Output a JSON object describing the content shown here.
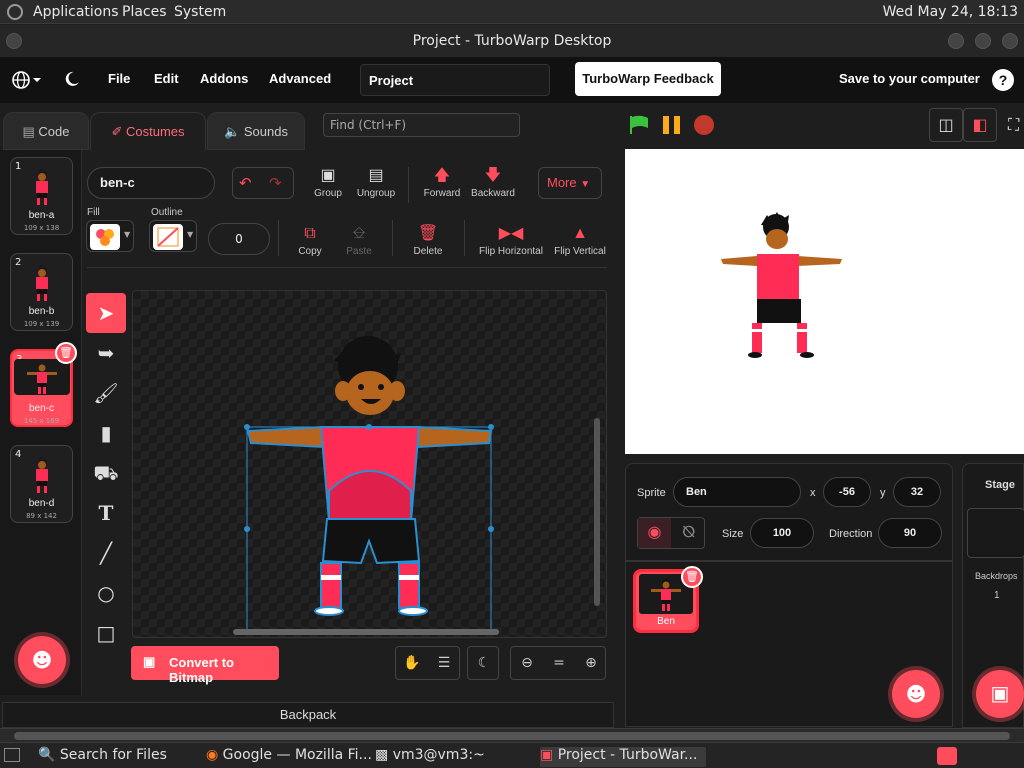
{
  "system_bar": {
    "menus": [
      "Applications",
      "Places",
      "System"
    ],
    "clock": "Wed May 24, 18:13"
  },
  "window": {
    "title": "Project - TurboWarp Desktop"
  },
  "menubar": {
    "items": [
      "File",
      "Edit",
      "Addons",
      "Advanced"
    ],
    "project_title": "Project",
    "feedback_label": "TurboWarp Feedback",
    "save_label": "Save to your computer",
    "help_glyph": "?"
  },
  "tabs": [
    {
      "label": "Code",
      "icon": "code-icon"
    },
    {
      "label": "Costumes",
      "icon": "brush-icon"
    },
    {
      "label": "Sounds",
      "icon": "speaker-icon"
    }
  ],
  "find": {
    "placeholder": "Find (Ctrl+F)"
  },
  "costumes": [
    {
      "num": "1",
      "name": "ben-a",
      "size": "109 x 138"
    },
    {
      "num": "2",
      "name": "ben-b",
      "size": "109 x 139"
    },
    {
      "num": "3",
      "name": "ben-c",
      "size": "145 x 169",
      "selected": true
    },
    {
      "num": "4",
      "name": "ben-d",
      "size": "89 x 142"
    }
  ],
  "paint": {
    "costume_name": "ben-c",
    "fill_label": "Fill",
    "outline_label": "Outline",
    "outline_width": "0",
    "buttons": {
      "group": "Group",
      "ungroup": "Ungroup",
      "forward": "Forward",
      "backward": "Backward",
      "more": "More",
      "copy": "Copy",
      "paste": "Paste",
      "delete": "Delete",
      "flip_h": "Flip Horizontal",
      "flip_v": "Flip Vertical"
    },
    "convert_label": "Convert to Bitmap",
    "zoom_reset": "="
  },
  "backpack_label": "Backpack",
  "sprite_info": {
    "sprite_label": "Sprite",
    "sprite_name": "Ben",
    "x_label": "x",
    "x_value": "-56",
    "y_label": "y",
    "y_value": "32",
    "size_label": "Size",
    "size_value": "100",
    "direction_label": "Direction",
    "direction_value": "90"
  },
  "sprites": [
    {
      "name": "Ben"
    }
  ],
  "stage_panel": {
    "label": "Stage",
    "backdrops_label": "Backdrops",
    "backdrops_count": "1"
  },
  "taskbar": {
    "tasks": [
      "Search for Files",
      "Google — Mozilla Fi...",
      "vm3@vm3:~",
      "Project - TurboWar..."
    ]
  },
  "colors": {
    "accent": "#ff4d5d",
    "green_flag": "#3cc13c",
    "pause": "#ffab19",
    "stop": "#c0392b"
  }
}
